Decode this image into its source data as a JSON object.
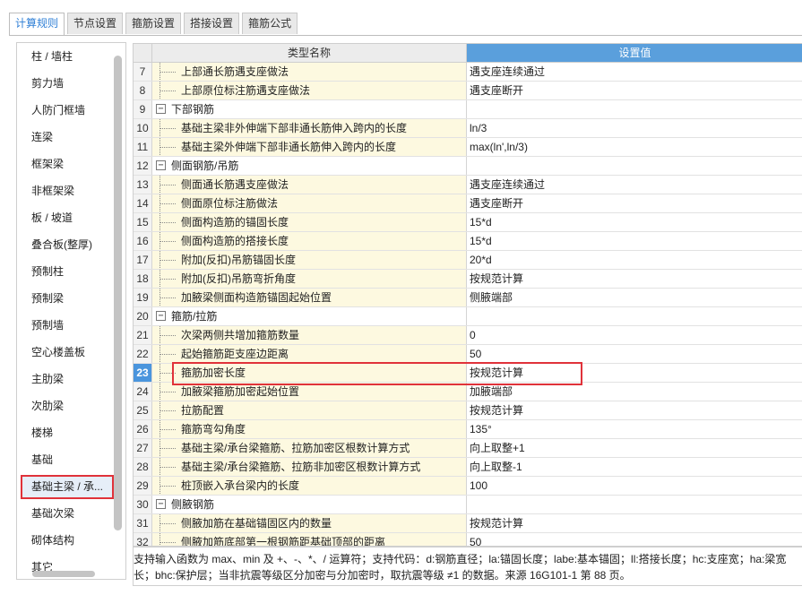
{
  "tabs": [
    "计算规则",
    "节点设置",
    "箍筋设置",
    "搭接设置",
    "箍筋公式"
  ],
  "active_tab": 0,
  "sidebar": {
    "items": [
      "柱 / 墙柱",
      "剪力墙",
      "人防门框墙",
      "连梁",
      "框架梁",
      "非框架梁",
      "板 / 坡道",
      "叠合板(整厚)",
      "预制柱",
      "预制梁",
      "预制墙",
      "空心楼盖板",
      "主肋梁",
      "次肋梁",
      "楼梯",
      "基础",
      "基础主梁 / 承...",
      "基础次梁",
      "砌体结构",
      "其它"
    ],
    "selected_index": 16
  },
  "grid": {
    "header_name": "类型名称",
    "header_value": "设置值",
    "current_row": "23",
    "rows": [
      {
        "n": "7",
        "name": "上部通长筋遇支座做法",
        "value": "遇支座连续通过",
        "group": false
      },
      {
        "n": "8",
        "name": "上部原位标注筋遇支座做法",
        "value": "遇支座断开",
        "group": false
      },
      {
        "n": "9",
        "name": "下部钢筋",
        "value": "",
        "group": true,
        "expander": "−"
      },
      {
        "n": "10",
        "name": "基础主梁非外伸端下部非通长筋伸入跨内的长度",
        "value": "ln/3",
        "group": false
      },
      {
        "n": "11",
        "name": "基础主梁外伸端下部非通长筋伸入跨内的长度",
        "value": "max(ln',ln/3)",
        "group": false
      },
      {
        "n": "12",
        "name": "侧面钢筋/吊筋",
        "value": "",
        "group": true,
        "expander": "−"
      },
      {
        "n": "13",
        "name": "侧面通长筋遇支座做法",
        "value": "遇支座连续通过",
        "group": false
      },
      {
        "n": "14",
        "name": "侧面原位标注筋做法",
        "value": "遇支座断开",
        "group": false
      },
      {
        "n": "15",
        "name": "侧面构造筋的锚固长度",
        "value": "15*d",
        "group": false
      },
      {
        "n": "16",
        "name": "侧面构造筋的搭接长度",
        "value": "15*d",
        "group": false
      },
      {
        "n": "17",
        "name": "附加(反扣)吊筋锚固长度",
        "value": "20*d",
        "group": false
      },
      {
        "n": "18",
        "name": "附加(反扣)吊筋弯折角度",
        "value": "按规范计算",
        "group": false
      },
      {
        "n": "19",
        "name": "加腋梁侧面构造筋锚固起始位置",
        "value": "侧腋端部",
        "group": false
      },
      {
        "n": "20",
        "name": "箍筋/拉筋",
        "value": "",
        "group": true,
        "expander": "−"
      },
      {
        "n": "21",
        "name": "次梁两侧共增加箍筋数量",
        "value": "0",
        "group": false
      },
      {
        "n": "22",
        "name": "起始箍筋距支座边距离",
        "value": "50",
        "group": false
      },
      {
        "n": "23",
        "name": "箍筋加密长度",
        "value": "按规范计算",
        "group": false
      },
      {
        "n": "24",
        "name": "加腋梁箍筋加密起始位置",
        "value": "加腋端部",
        "group": false
      },
      {
        "n": "25",
        "name": "拉筋配置",
        "value": "按规范计算",
        "group": false
      },
      {
        "n": "26",
        "name": "箍筋弯勾角度",
        "value": "135°",
        "group": false
      },
      {
        "n": "27",
        "name": "基础主梁/承台梁箍筋、拉筋加密区根数计算方式",
        "value": "向上取整+1",
        "group": false
      },
      {
        "n": "28",
        "name": "基础主梁/承台梁箍筋、拉筋非加密区根数计算方式",
        "value": "向上取整-1",
        "group": false
      },
      {
        "n": "29",
        "name": "桩顶嵌入承台梁内的长度",
        "value": "100",
        "group": false
      },
      {
        "n": "30",
        "name": "侧腋钢筋",
        "value": "",
        "group": true,
        "expander": "−"
      },
      {
        "n": "31",
        "name": "侧腋加筋在基础锚固区内的数量",
        "value": "按规范计算",
        "group": false
      },
      {
        "n": "32",
        "name": "侧腋加筋底部第一根钢筋距基础顶部的距离",
        "value": "50",
        "group": false
      }
    ]
  },
  "footer": {
    "line1": "支持输入函数为 max、min 及 +、-、*、/ 运算符；支持代码：d:钢筋直径；la:锚固长度；labe:基本锚固；ll:搭接长度；hc:支座宽；ha:梁宽",
    "line2": "长；bhc:保护层；当非抗震等级区分加密与分加密时，取抗震等级 ≠1 的数据。来源 16G101-1 第 88 页。"
  }
}
